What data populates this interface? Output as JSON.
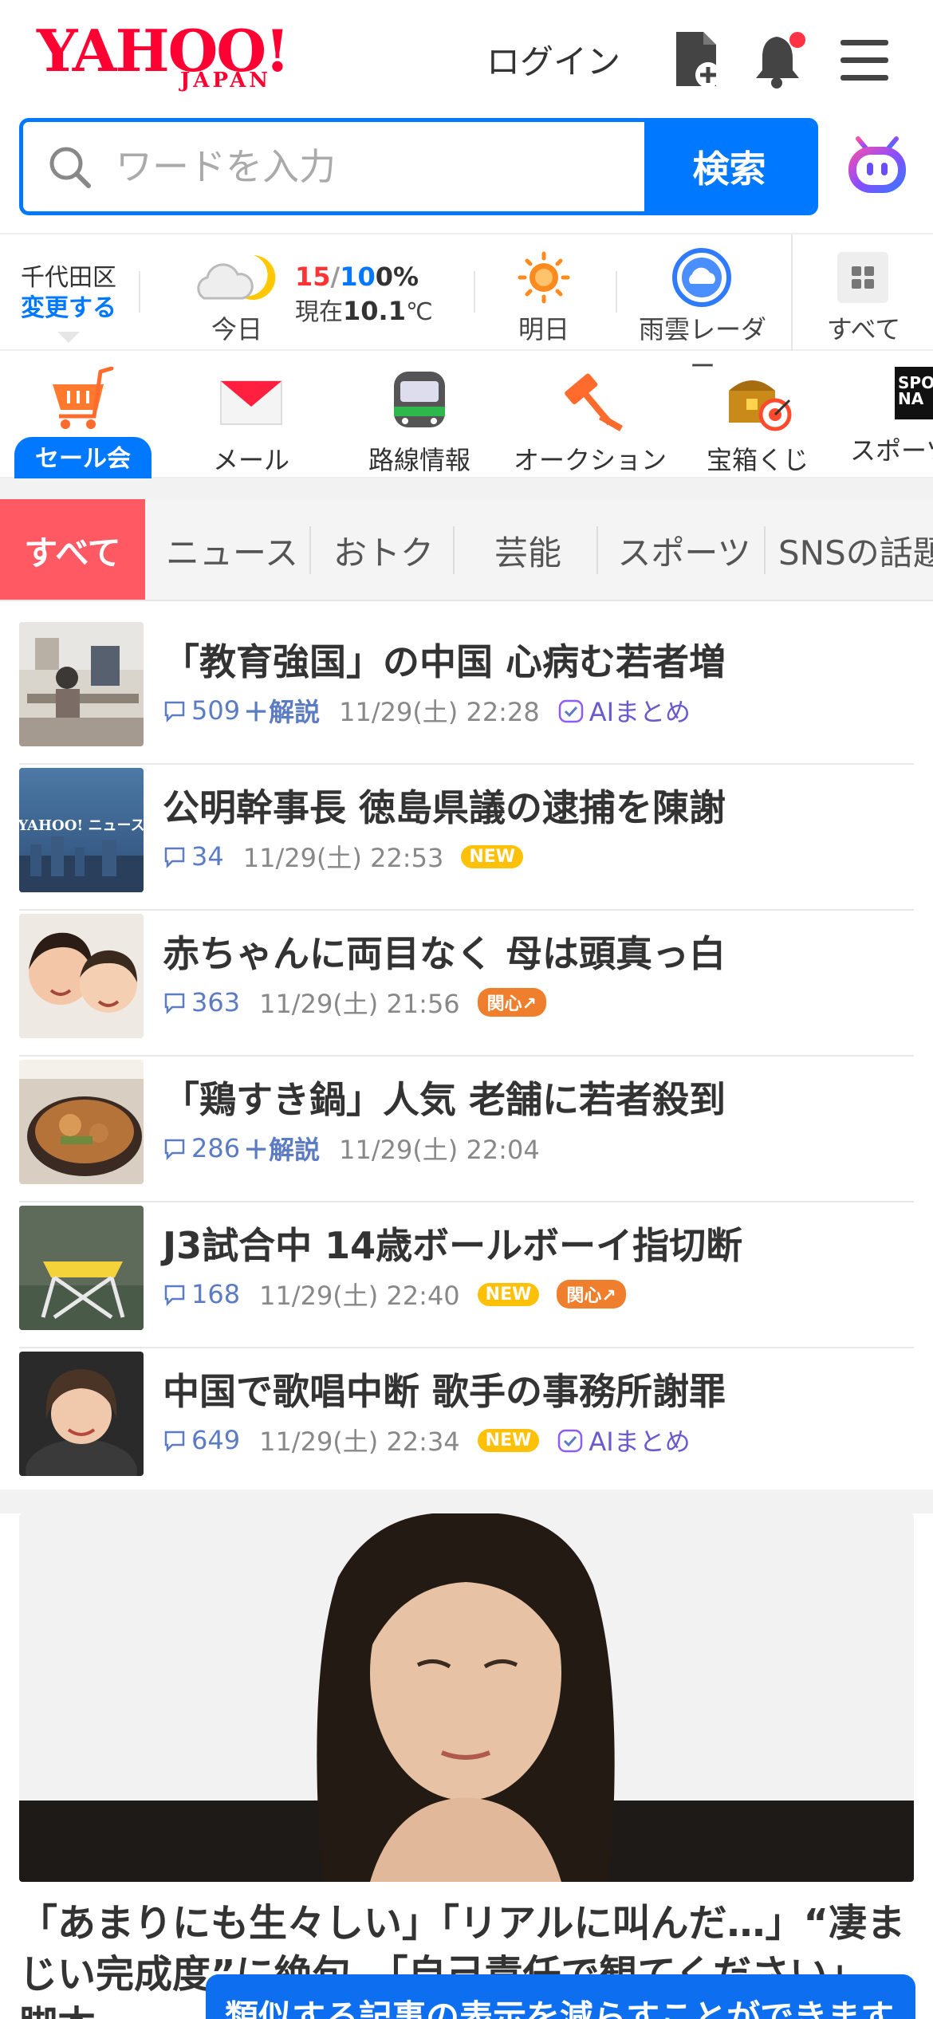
{
  "header": {
    "logo_text": "YAHOO!",
    "logo_sub": "JAPAN",
    "login_label": "ログイン"
  },
  "search": {
    "placeholder": "ワードを入力",
    "button_label": "検索"
  },
  "weather": {
    "location": "千代田区",
    "change_label": "変更する",
    "today_label": "今日",
    "high": "15",
    "sep": "/",
    "low": "10",
    "rain": "0%",
    "now_prefix": "現在",
    "now_temp": "10.1",
    "now_unit": "℃",
    "tomorrow_label": "明日",
    "radar_label": "雨雲レーダー",
    "all_label": "すべて"
  },
  "services": {
    "sale_label": "セール会場",
    "mail_label": "メール",
    "transit_label": "路線情報",
    "auction_label": "オークション",
    "lottery_label": "宝箱くじ",
    "sports_label": "スポーツ"
  },
  "tabs": [
    "すべて",
    "ニュース",
    "おトク",
    "芸能",
    "スポーツ",
    "SNSの話題"
  ],
  "news": [
    {
      "title": "「教育強国」の中国 心病む若者増",
      "comments": "509",
      "plus": "＋解説",
      "time": "11/29(土) 22:28",
      "new": "",
      "kanshin": "",
      "ai": "AIまとめ"
    },
    {
      "title": "公明幹事長 徳島県議の逮捕を陳謝",
      "comments": "34",
      "plus": "",
      "time": "11/29(土) 22:53",
      "new": "NEW",
      "kanshin": "",
      "ai": ""
    },
    {
      "title": "赤ちゃんに両目なく 母は頭真っ白",
      "comments": "363",
      "plus": "",
      "time": "11/29(土) 21:56",
      "new": "",
      "kanshin": "関心↗",
      "ai": ""
    },
    {
      "title": "「鶏すき鍋」人気 老舗に若者殺到",
      "comments": "286",
      "plus": "＋解説",
      "time": "11/29(土) 22:04",
      "new": "",
      "kanshin": "",
      "ai": ""
    },
    {
      "title": "J3試合中 14歳ボールボーイ指切断",
      "comments": "168",
      "plus": "",
      "time": "11/29(土) 22:40",
      "new": "NEW",
      "kanshin": "関心↗",
      "ai": ""
    },
    {
      "title": "中国で歌唱中断 歌手の事務所謝罪",
      "comments": "649",
      "plus": "",
      "time": "11/29(土) 22:34",
      "new": "NEW",
      "kanshin": "",
      "ai": "AIまとめ"
    }
  ],
  "feature": {
    "title_line1": "「あまりにも生々しい」「リアルに叫んだ…」“凄ま",
    "title_line2": "じい完成度”に絶句　「自己責任で観てください」",
    "title_line3": "脚本…"
  },
  "toast": {
    "text": "類似する記事の表示を減らすことができます"
  },
  "colors": {
    "brand_red": "#ff0033",
    "accent_blue": "#0078ff",
    "tab_active": "#ff5a64",
    "new_badge": "#ffc107",
    "kanshin_badge": "#f07f2d"
  }
}
